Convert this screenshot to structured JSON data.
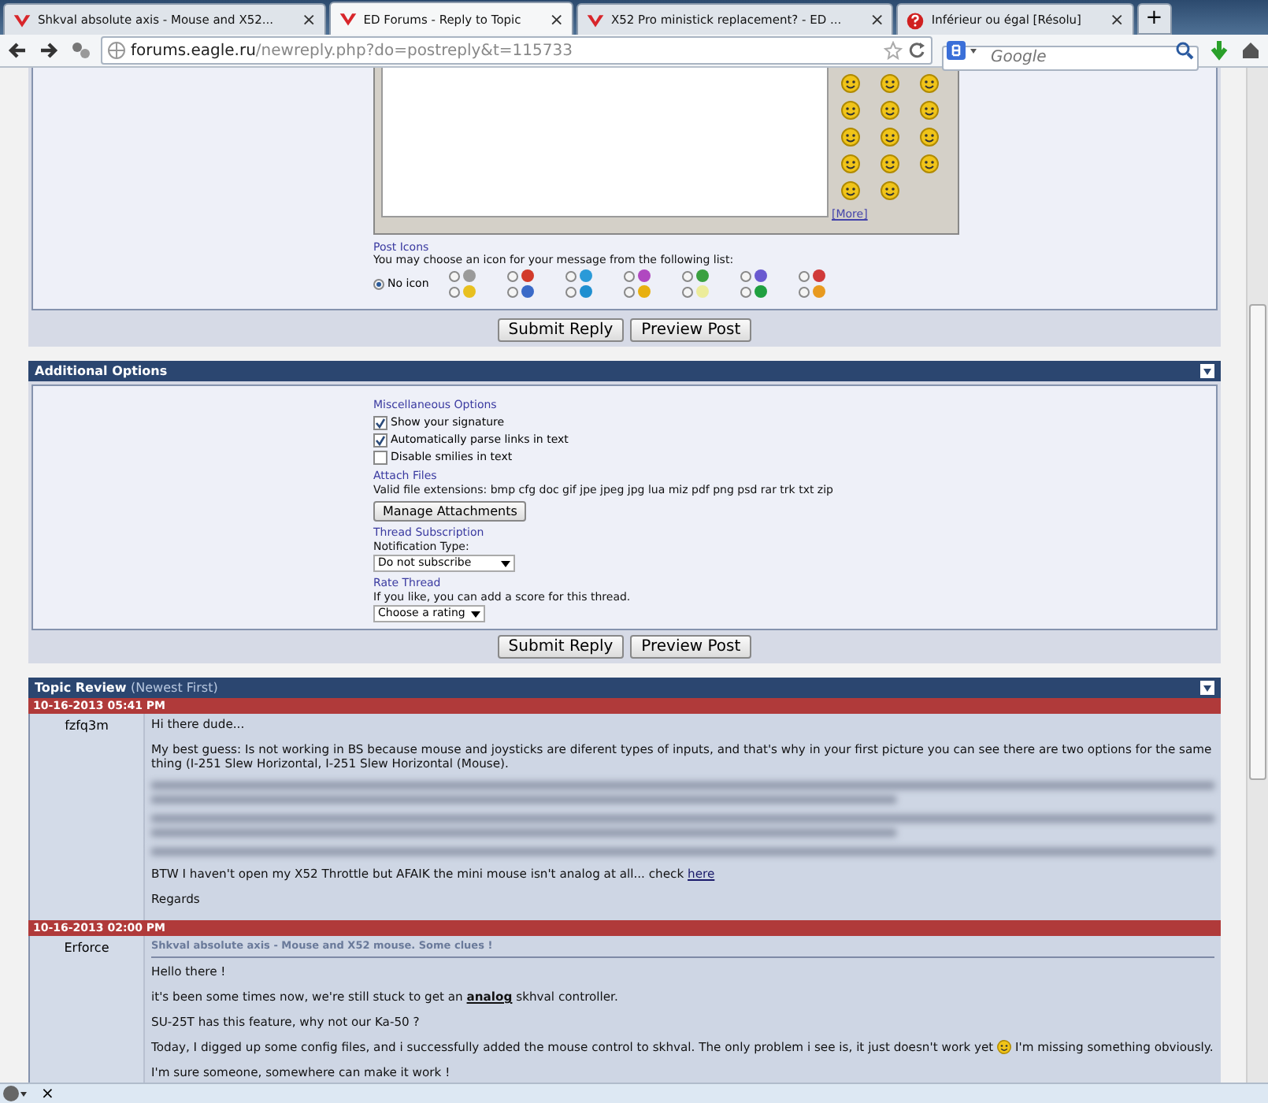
{
  "browser": {
    "tabs": [
      {
        "title": "Shkval absolute axis - Mouse and X52...",
        "kind": "eagle",
        "selected": false
      },
      {
        "title": "ED Forums - Reply to Topic",
        "kind": "eagle",
        "selected": true
      },
      {
        "title": "X52 Pro ministick replacement? - ED ...",
        "kind": "eagle",
        "selected": false
      },
      {
        "title": "Inférieur ou égal [Résolu]",
        "kind": "help",
        "selected": false
      }
    ],
    "new_tab": "+",
    "close": "×",
    "address": {
      "host": "forums.eagle.ru",
      "path": "/newreply.php?do=postreply&t=115733"
    },
    "search": {
      "placeholder": "Google"
    }
  },
  "editor": {
    "more_link": "[More]"
  },
  "post_icons": {
    "title": "Post Icons",
    "hint": "You may choose an icon for your message from the following list:",
    "options": [
      {
        "label": "No icon",
        "selected": true
      },
      {
        "color": "#9a9a9a",
        "selected": false
      },
      {
        "color": "#d23a2a",
        "selected": false
      },
      {
        "color": "#2a9ad8",
        "selected": false
      },
      {
        "color": "#b048c0",
        "selected": false
      },
      {
        "color": "#3aa040",
        "selected": false
      },
      {
        "color": "#6a5ad0",
        "selected": false
      },
      {
        "color": "#d03a3a",
        "selected": false
      },
      {
        "color": "#e8c020",
        "selected": false
      },
      {
        "color": "#3a6ac8",
        "selected": false
      },
      {
        "color": "#1f8fd0",
        "selected": false
      },
      {
        "color": "#e8b010",
        "selected": false
      },
      {
        "color": "#ecec9a",
        "selected": false
      },
      {
        "color": "#20a040",
        "selected": false
      },
      {
        "color": "#e89a20",
        "selected": false
      }
    ]
  },
  "reply_buttons": [
    "Submit Reply",
    "Preview Post"
  ],
  "additional_options": {
    "title": "Additional Options",
    "misc": {
      "title": "Miscellaneous Options",
      "checkboxes": [
        {
          "label": "Show your signature",
          "checked": true
        },
        {
          "label": "Automatically parse links in text",
          "checked": true
        },
        {
          "label": "Disable smilies in text",
          "checked": false
        }
      ]
    },
    "attach": {
      "title": "Attach Files",
      "extensions": "Valid file extensions: bmp cfg doc gif jpe jpeg jpg lua miz pdf png psd rar trk txt zip",
      "button": "Manage Attachments"
    },
    "subscription": {
      "title": "Thread Subscription",
      "label": "Notification Type:",
      "value": "Do not subscribe"
    },
    "rating": {
      "title": "Rate Thread",
      "hint": "If you like, you can add a score for this thread.",
      "value": "Choose a rating"
    },
    "buttons": [
      "Submit Reply",
      "Preview Post"
    ]
  },
  "topic_review": {
    "title": "Topic Review",
    "subtitle": "(Newest First)",
    "posts": [
      {
        "date": "10-16-2013 05:41 PM",
        "author": "fzfq3m",
        "paragraphs": [
          {
            "kind": "text",
            "parts": [
              {
                "kind": "text",
                "text": "Hi there dude..."
              }
            ]
          },
          {
            "kind": "text",
            "parts": [
              {
                "kind": "text",
                "text": "My best guess: Is not working in BS because mouse and joysticks are diferent types of inputs, and that's why in your first picture you can see there are two options for the same thing (I-251 Slew Horizontal, I-251 Slew Horizontal (Mouse)."
              }
            ]
          },
          {
            "kind": "blurred_block"
          },
          {
            "kind": "blurred_block"
          },
          {
            "kind": "blurred_line"
          },
          {
            "kind": "text",
            "parts": [
              {
                "kind": "text",
                "text": "BTW I haven't open my X52 Throttle but AFAIK the mini mouse isn't analog at all... check "
              },
              {
                "kind": "link",
                "text": "here"
              }
            ]
          },
          {
            "kind": "text",
            "parts": [
              {
                "kind": "text",
                "text": "Regards"
              }
            ]
          }
        ]
      },
      {
        "date": "10-16-2013 02:00 PM",
        "author": "Erforce",
        "title": "Shkval absolute axis - Mouse and X52 mouse. Some clues !",
        "paragraphs": [
          {
            "kind": "text",
            "parts": [
              {
                "kind": "text",
                "text": "Hello there !"
              }
            ]
          },
          {
            "kind": "text",
            "parts": [
              {
                "kind": "text",
                "text": "it's been some times now, we're still stuck to get an **analog** skhval controller."
              }
            ]
          },
          {
            "kind": "text",
            "parts": [
              {
                "kind": "text",
                "text": "SU-25T has this feature, why not our Ka-50 ?"
              }
            ]
          },
          {
            "kind": "text",
            "parts": [
              {
                "kind": "text",
                "text": "Today, I digged up some config files, and i successfully added the mouse control to skhval. The only problem i see is, it just doesn't work yet "
              },
              {
                "kind": "smiley"
              },
              {
                "kind": "text",
                "text": " I'm missing something obviously."
              }
            ]
          },
          {
            "kind": "text",
            "parts": [
              {
                "kind": "text",
                "text": "I'm sure someone, somewhere can make it work !"
              }
            ]
          }
        ]
      }
    ]
  },
  "addon_bar": {
    "close": "×"
  }
}
